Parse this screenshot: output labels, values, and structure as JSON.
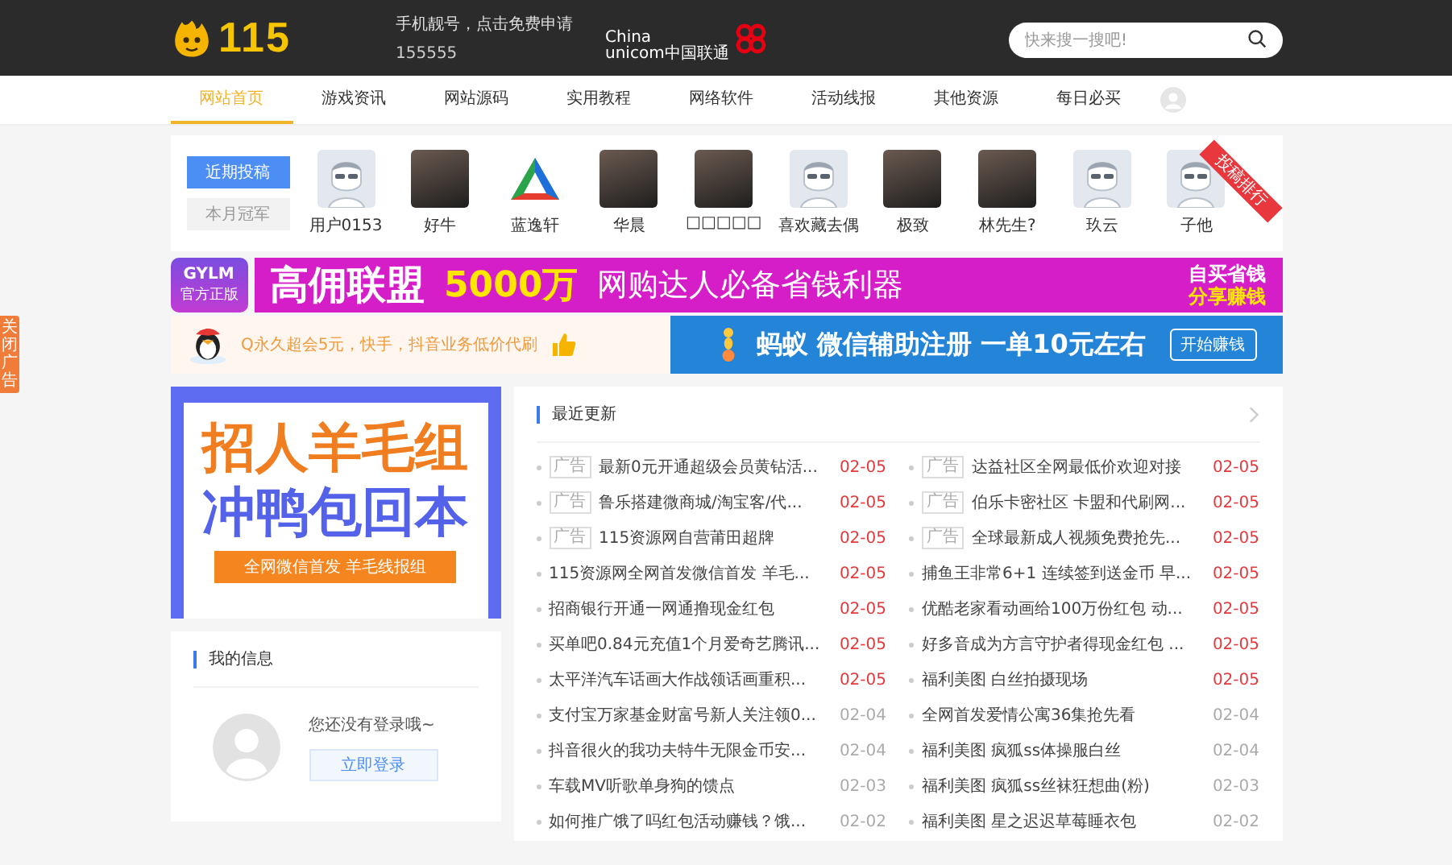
{
  "header": {
    "logo_text": "115",
    "promo": {
      "line1": "手机靓号，点击免费申请",
      "line2": "155555"
    },
    "carrier": {
      "line1": "China",
      "line2": "unicom中国联通"
    },
    "search": {
      "placeholder": "快来搜一搜吧!"
    }
  },
  "nav": [
    {
      "label": "网站首页",
      "selected": true
    },
    {
      "label": "游戏资讯",
      "selected": false
    },
    {
      "label": "网站源码",
      "selected": false
    },
    {
      "label": "实用教程",
      "selected": false
    },
    {
      "label": "网络软件",
      "selected": false
    },
    {
      "label": "活动线报",
      "selected": false
    },
    {
      "label": "其他资源",
      "selected": false
    },
    {
      "label": "每日必买",
      "selected": false
    }
  ],
  "close_ad": "关闭广告",
  "contributors": {
    "tabs": [
      {
        "label": "近期投稿",
        "selected": true
      },
      {
        "label": "本月冠军",
        "selected": false
      }
    ],
    "ribbon": "投稿排行",
    "users": [
      {
        "name": "用户0153",
        "kind": "default"
      },
      {
        "name": "好牛",
        "kind": "photo"
      },
      {
        "name": "蓝逸轩",
        "kind": "logo"
      },
      {
        "name": "华晨",
        "kind": "photo"
      },
      {
        "name": "□□□□□",
        "kind": "photo"
      },
      {
        "name": "喜欢藏去偶",
        "kind": "default"
      },
      {
        "name": "极致",
        "kind": "photo"
      },
      {
        "name": "林先生?",
        "kind": "photo"
      },
      {
        "name": "玖云",
        "kind": "default"
      },
      {
        "name": "子他",
        "kind": "default"
      }
    ]
  },
  "banner_top": {
    "logo_text": "GYLM",
    "logo_sub": "官方正版",
    "brand": "高佣联盟",
    "amount": "5000万",
    "slogan": "网购达人必备省钱利器",
    "badge": [
      "自买省钱",
      "分享赚钱"
    ]
  },
  "banner_row": {
    "left": "Q永久超会5元，快手，抖音业务低价代刷",
    "right": "蚂蚁 微信辅助注册 一单10元左右",
    "right_button": "开始赚钱"
  },
  "poster": {
    "lines": [
      "招人羊毛组",
      "冲鸭包回本"
    ],
    "strip": "全网微信首发 羊毛线报组"
  },
  "my_info": {
    "title": "我的信息",
    "message": "您还没有登录哦~",
    "login_button": "立即登录"
  },
  "recent": {
    "title": "最近更新",
    "items": [
      {
        "tag": "广告",
        "title": "最新0元开通超级会员黄钻活...",
        "date": "02-05",
        "hot": true
      },
      {
        "tag": "广告",
        "title": "达益社区全网最低价欢迎对接",
        "date": "02-05",
        "hot": true
      },
      {
        "tag": "广告",
        "title": "鲁乐搭建微商城/淘宝客/代...",
        "date": "02-05",
        "hot": true
      },
      {
        "tag": "广告",
        "title": "伯乐卡密社区 卡盟和代刷网...",
        "date": "02-05",
        "hot": true
      },
      {
        "tag": "广告",
        "title": "115资源网自营莆田超牌",
        "date": "02-05",
        "hot": true
      },
      {
        "tag": "广告",
        "title": "全球最新成人视频免费抢先...",
        "date": "02-05",
        "hot": true
      },
      {
        "title": "115资源网全网首发微信首发 羊毛...",
        "date": "02-05",
        "hot": true
      },
      {
        "title": "捕鱼王非常6+1 连续签到送金币 早...",
        "date": "02-05",
        "hot": true
      },
      {
        "title": "招商银行开通一网通撸现金红包",
        "date": "02-05",
        "hot": true
      },
      {
        "title": "优酷老家看动画给100万份红包 动...",
        "date": "02-05",
        "hot": true
      },
      {
        "title": "买单吧0.84元充值1个月爱奇艺腾讯...",
        "date": "02-05",
        "hot": true
      },
      {
        "title": "好多音成为方言守护者得现金红包 ...",
        "date": "02-05",
        "hot": true
      },
      {
        "title": "太平洋汽车话画大作战领话画重积...",
        "date": "02-05",
        "hot": true
      },
      {
        "title": "福利美图 白丝拍摄现场",
        "date": "02-05",
        "hot": true
      },
      {
        "title": "支付宝万家基金财富号新人关注领0...",
        "date": "02-04",
        "hot": false
      },
      {
        "title": "全网首发爱情公寓36集抢先看",
        "date": "02-04",
        "hot": false
      },
      {
        "title": "抖音很火的我功夫特牛无限金币安...",
        "date": "02-04",
        "hot": false
      },
      {
        "title": "福利美图 疯狐ss体操服白丝",
        "date": "02-04",
        "hot": false
      },
      {
        "title": "车载MV听歌单身狗的馈点",
        "date": "02-03",
        "hot": false
      },
      {
        "title": "福利美图 疯狐ss丝袜狂想曲(粉)",
        "date": "02-03",
        "hot": false
      },
      {
        "title": "如何推广饿了吗红包活动赚钱？饿...",
        "date": "02-02",
        "hot": false
      },
      {
        "title": "福利美图 星之迟迟草莓睡衣包",
        "date": "02-02",
        "hot": false
      }
    ]
  }
}
